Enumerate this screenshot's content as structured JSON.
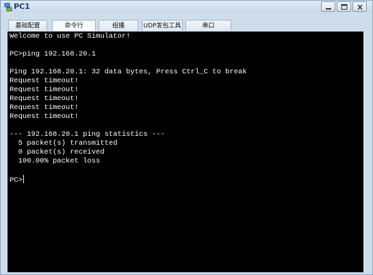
{
  "window": {
    "title": "PC1"
  },
  "tabs": [
    {
      "label": "基础配置"
    },
    {
      "label": "命令行"
    },
    {
      "label": "组播"
    },
    {
      "label": "UDP发包工具"
    },
    {
      "label": "串口"
    }
  ],
  "terminal": {
    "lines": [
      "Welcome to use PC Simulator!",
      "",
      "PC>ping 192.168.20.1",
      "",
      "Ping 192.168.20.1: 32 data bytes, Press Ctrl_C to break",
      "Request timeout!",
      "Request timeout!",
      "Request timeout!",
      "Request timeout!",
      "Request timeout!",
      "",
      "--- 192.168.20.1 ping statistics ---",
      "  5 packet(s) transmitted",
      "  0 packet(s) received",
      "  100.00% packet loss",
      "",
      "PC>"
    ]
  }
}
